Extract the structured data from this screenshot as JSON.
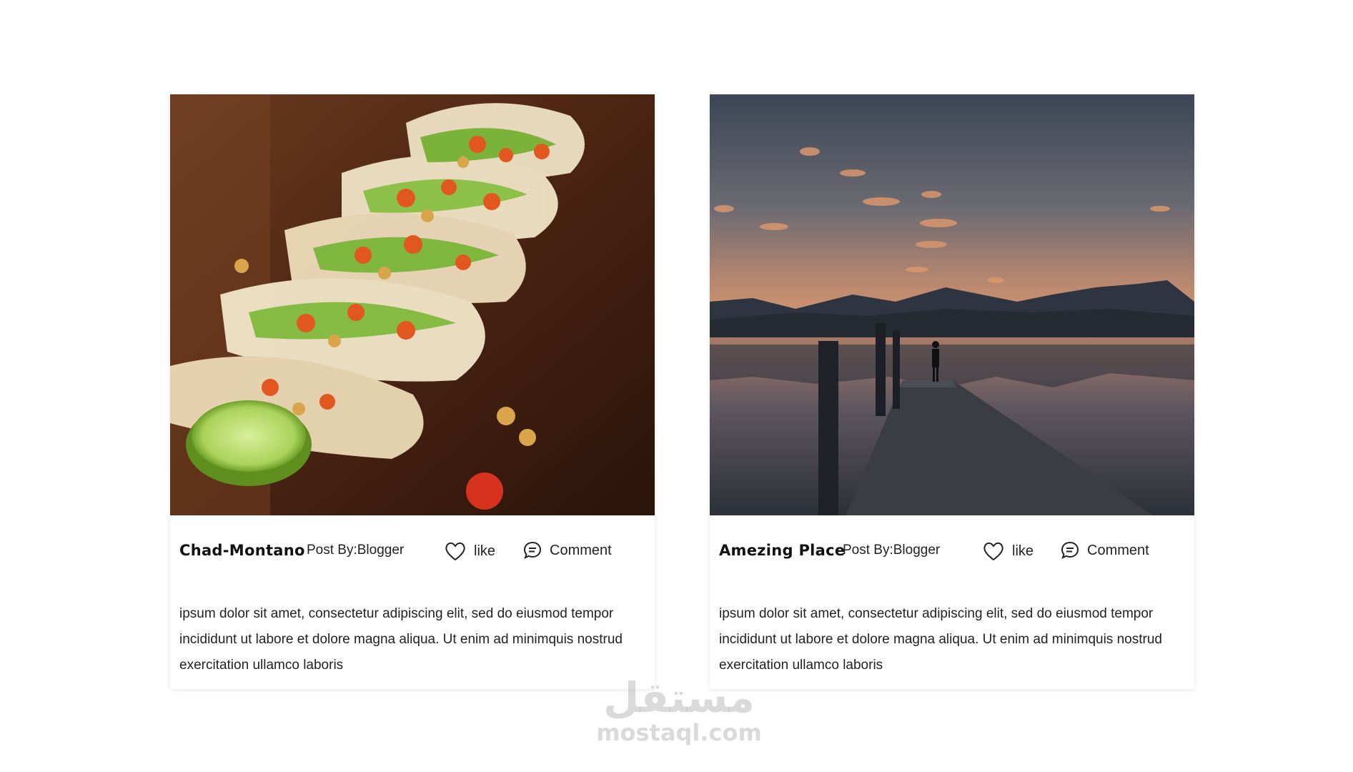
{
  "posts": [
    {
      "image_icon": "tacos-photo",
      "title": "Chad-Montano",
      "posted_by": "Post By:Blogger",
      "like_label": "like",
      "comment_label": "Comment",
      "body": "ipsum dolor sit amet, consectetur adipiscing elit, sed do eiusmod tempor incididunt ut labore et dolore magna aliqua. Ut enim ad minimquis nostrud exercitation ullamco laboris"
    },
    {
      "image_icon": "lake-pier-sunset-photo",
      "title": "Amezing Place",
      "posted_by": "Post By:Blogger",
      "like_label": "like",
      "comment_label": "Comment",
      "body": "ipsum dolor sit amet, consectetur adipiscing elit, sed do eiusmod tempor incididunt ut labore et dolore magna aliqua. Ut enim ad minimquis nostrud exercitation ullamco laboris"
    }
  ],
  "watermark": {
    "arabic": "مستقل",
    "latin": "mostaql.com"
  }
}
